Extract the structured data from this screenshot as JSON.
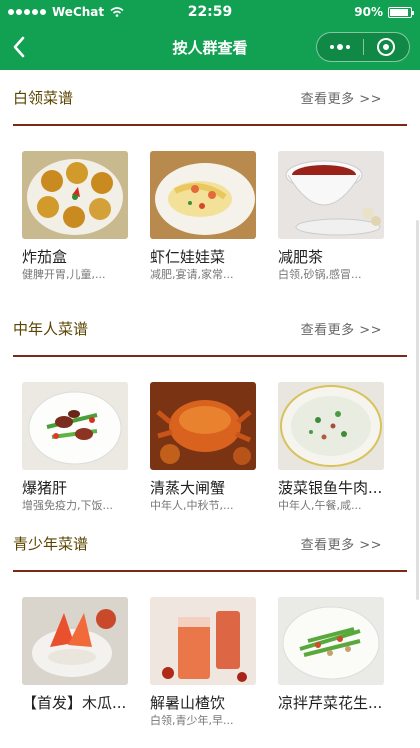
{
  "status_bar": {
    "carrier": "WeChat",
    "time": "22:59",
    "battery": "90%",
    "battery_level": 0.9
  },
  "nav": {
    "title": "按人群查看",
    "back_icon": "chevron-left-icon",
    "more_icon": "more-dots-icon",
    "close_icon": "target-circle-icon"
  },
  "colors": {
    "header": "#12a152",
    "section_title": "#5a4400",
    "rule": "#7a2a1a"
  },
  "sections": [
    {
      "title": "白领菜谱",
      "more": "查看更多 >>",
      "items": [
        {
          "name": "炸茄盒",
          "tags": "健脾开胃,儿童,..."
        },
        {
          "name": "虾仁娃娃菜",
          "tags": "减肥,宴请,家常..."
        },
        {
          "name": "减肥茶",
          "tags": "白领,砂锅,感冒..."
        }
      ]
    },
    {
      "title": "中年人菜谱",
      "more": "查看更多 >>",
      "items": [
        {
          "name": "爆猪肝",
          "tags": "增强免疫力,下饭..."
        },
        {
          "name": "清蒸大闸蟹",
          "tags": "中年人,中秋节,..."
        },
        {
          "name": "菠菜银鱼牛肉...",
          "tags": "中年人,午餐,咸..."
        }
      ]
    },
    {
      "title": "青少年菜谱",
      "more": "查看更多 >>",
      "items": [
        {
          "name": "【首发】木瓜...",
          "tags": ""
        },
        {
          "name": "解暑山楂饮",
          "tags": "白领,青少年,早..."
        },
        {
          "name": "凉拌芹菜花生...",
          "tags": ""
        }
      ]
    }
  ]
}
